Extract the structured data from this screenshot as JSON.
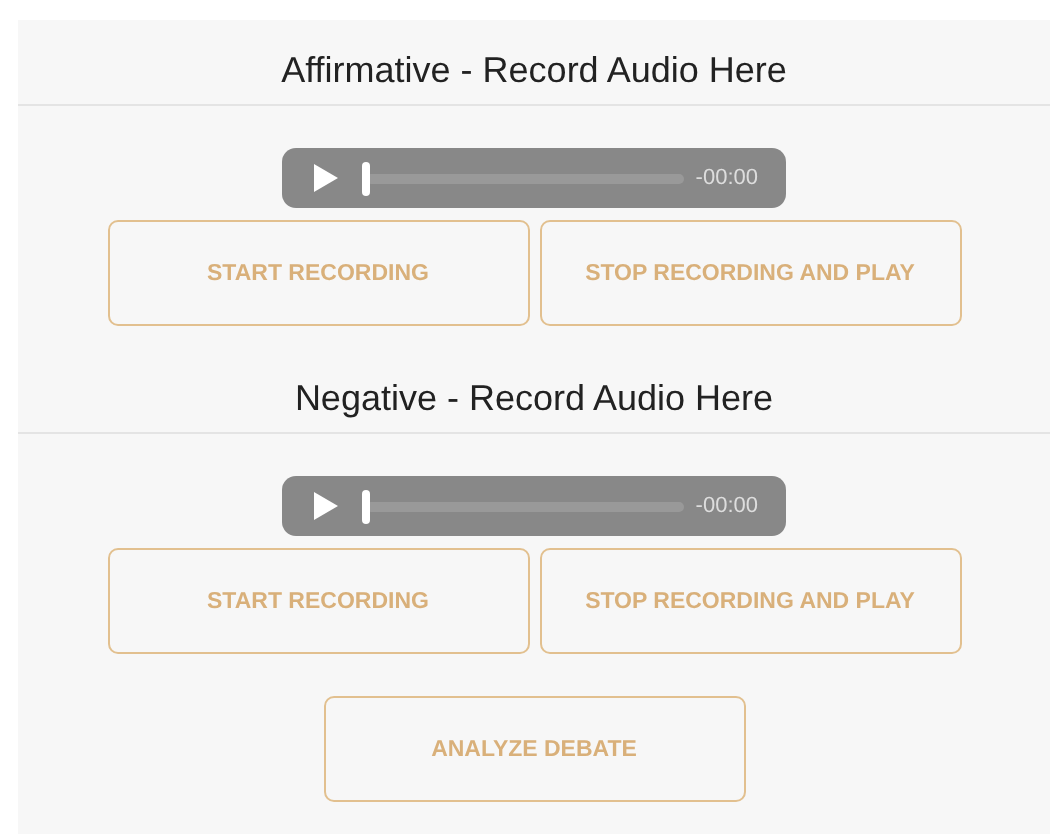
{
  "sections": [
    {
      "title": "Affirmative - Record Audio Here",
      "player": {
        "time": "-00:00",
        "level": 0
      },
      "buttons": [
        "START RECORDING",
        "STOP RECORDING AND PLAY"
      ]
    },
    {
      "title": "Negative - Record Audio Here",
      "player": {
        "time": "-00:00",
        "level": 0
      },
      "buttons": [
        "START RECORDING",
        "STOP RECORDING AND PLAY"
      ]
    }
  ],
  "analyze_button": "ANALYZE DEBATE"
}
